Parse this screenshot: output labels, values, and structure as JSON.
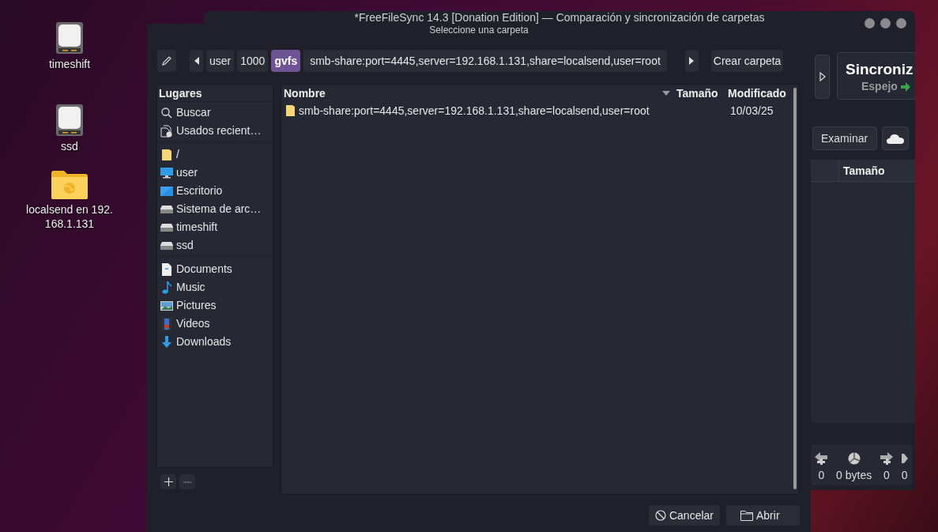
{
  "desktop_icons": [
    {
      "label": "timeshift",
      "kind": "drive"
    },
    {
      "label": "ssd",
      "kind": "drive"
    },
    {
      "label": "localsend en 192.\n168.1.131",
      "kind": "network_folder"
    }
  ],
  "background_window": {
    "title": "*FreeFileSync 14.3 [Donation Edition] — Comparación y sincronización de carpetas",
    "sync_button": {
      "title": "Sincroniz",
      "subtitle": "Espejo"
    },
    "browse_button": "Examinar",
    "column": "Tamaño",
    "stats": [
      {
        "kind": "left",
        "text": "0"
      },
      {
        "kind": "size",
        "text": "0 bytes"
      },
      {
        "kind": "right",
        "text": "0"
      },
      {
        "kind": "update",
        "text": "0"
      }
    ]
  },
  "dialog": {
    "title": "Seleccione una carpeta",
    "path": [
      {
        "label": "user",
        "selected": false
      },
      {
        "label": "1000",
        "selected": false
      },
      {
        "label": "gvfs",
        "selected": true
      },
      {
        "label": "smb-share:port=4445,server=192.168.1.131,share=localsend,user=root",
        "selected": false
      }
    ],
    "create_folder": "Crear carpeta",
    "places_title": "Lugares",
    "places": [
      [
        {
          "kind": "search",
          "label": "Buscar"
        },
        {
          "kind": "recent",
          "label": "Usados recient…"
        }
      ],
      [
        {
          "kind": "folder",
          "label": "/"
        },
        {
          "kind": "computer",
          "label": "user"
        },
        {
          "kind": "desktop",
          "label": "Escritorio"
        },
        {
          "kind": "drive",
          "label": "Sistema de arc…"
        },
        {
          "kind": "drive",
          "label": "timeshift"
        },
        {
          "kind": "drive",
          "label": "ssd"
        }
      ],
      [
        {
          "kind": "document",
          "label": "Documents"
        },
        {
          "kind": "music",
          "label": "Music"
        },
        {
          "kind": "pictures",
          "label": "Pictures"
        },
        {
          "kind": "videos",
          "label": "Videos"
        },
        {
          "kind": "downloads",
          "label": "Downloads"
        }
      ]
    ],
    "columns": [
      {
        "label": "Nombre",
        "sorted": true
      },
      {
        "label": "Tamaño",
        "sorted": false
      },
      {
        "label": "Modificado",
        "sorted": false
      }
    ],
    "rows": [
      {
        "name": "smb-share:port=4445,server=192.168.1.131,share=localsend,user=root",
        "modified": "10/03/25"
      }
    ],
    "buttons": [
      {
        "kind": "cancel",
        "label": "Cancelar"
      },
      {
        "kind": "open",
        "label": "Abrir"
      }
    ]
  }
}
